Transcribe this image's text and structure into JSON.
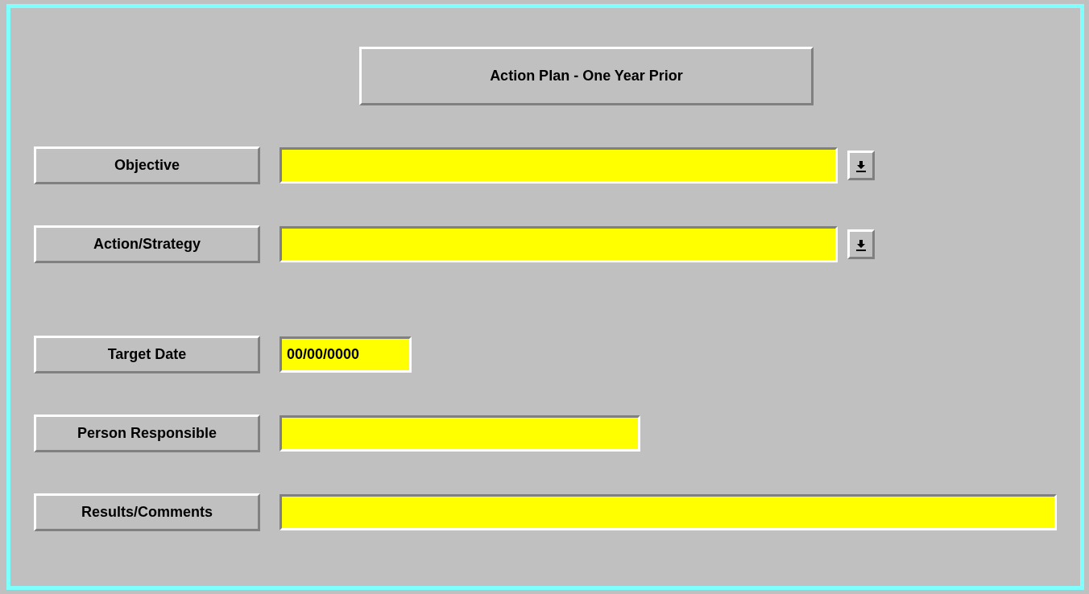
{
  "title": "Action Plan - One Year Prior",
  "rows": [
    {
      "label": "Objective",
      "kind": "combo"
    },
    {
      "label": "Action/Strategy",
      "kind": "combo"
    },
    {
      "label": "Target Date",
      "kind": "text",
      "value": "00/00/0000"
    },
    {
      "label": "Person Responsible",
      "kind": "text"
    },
    {
      "label": "Results/Comments",
      "kind": "text"
    }
  ]
}
